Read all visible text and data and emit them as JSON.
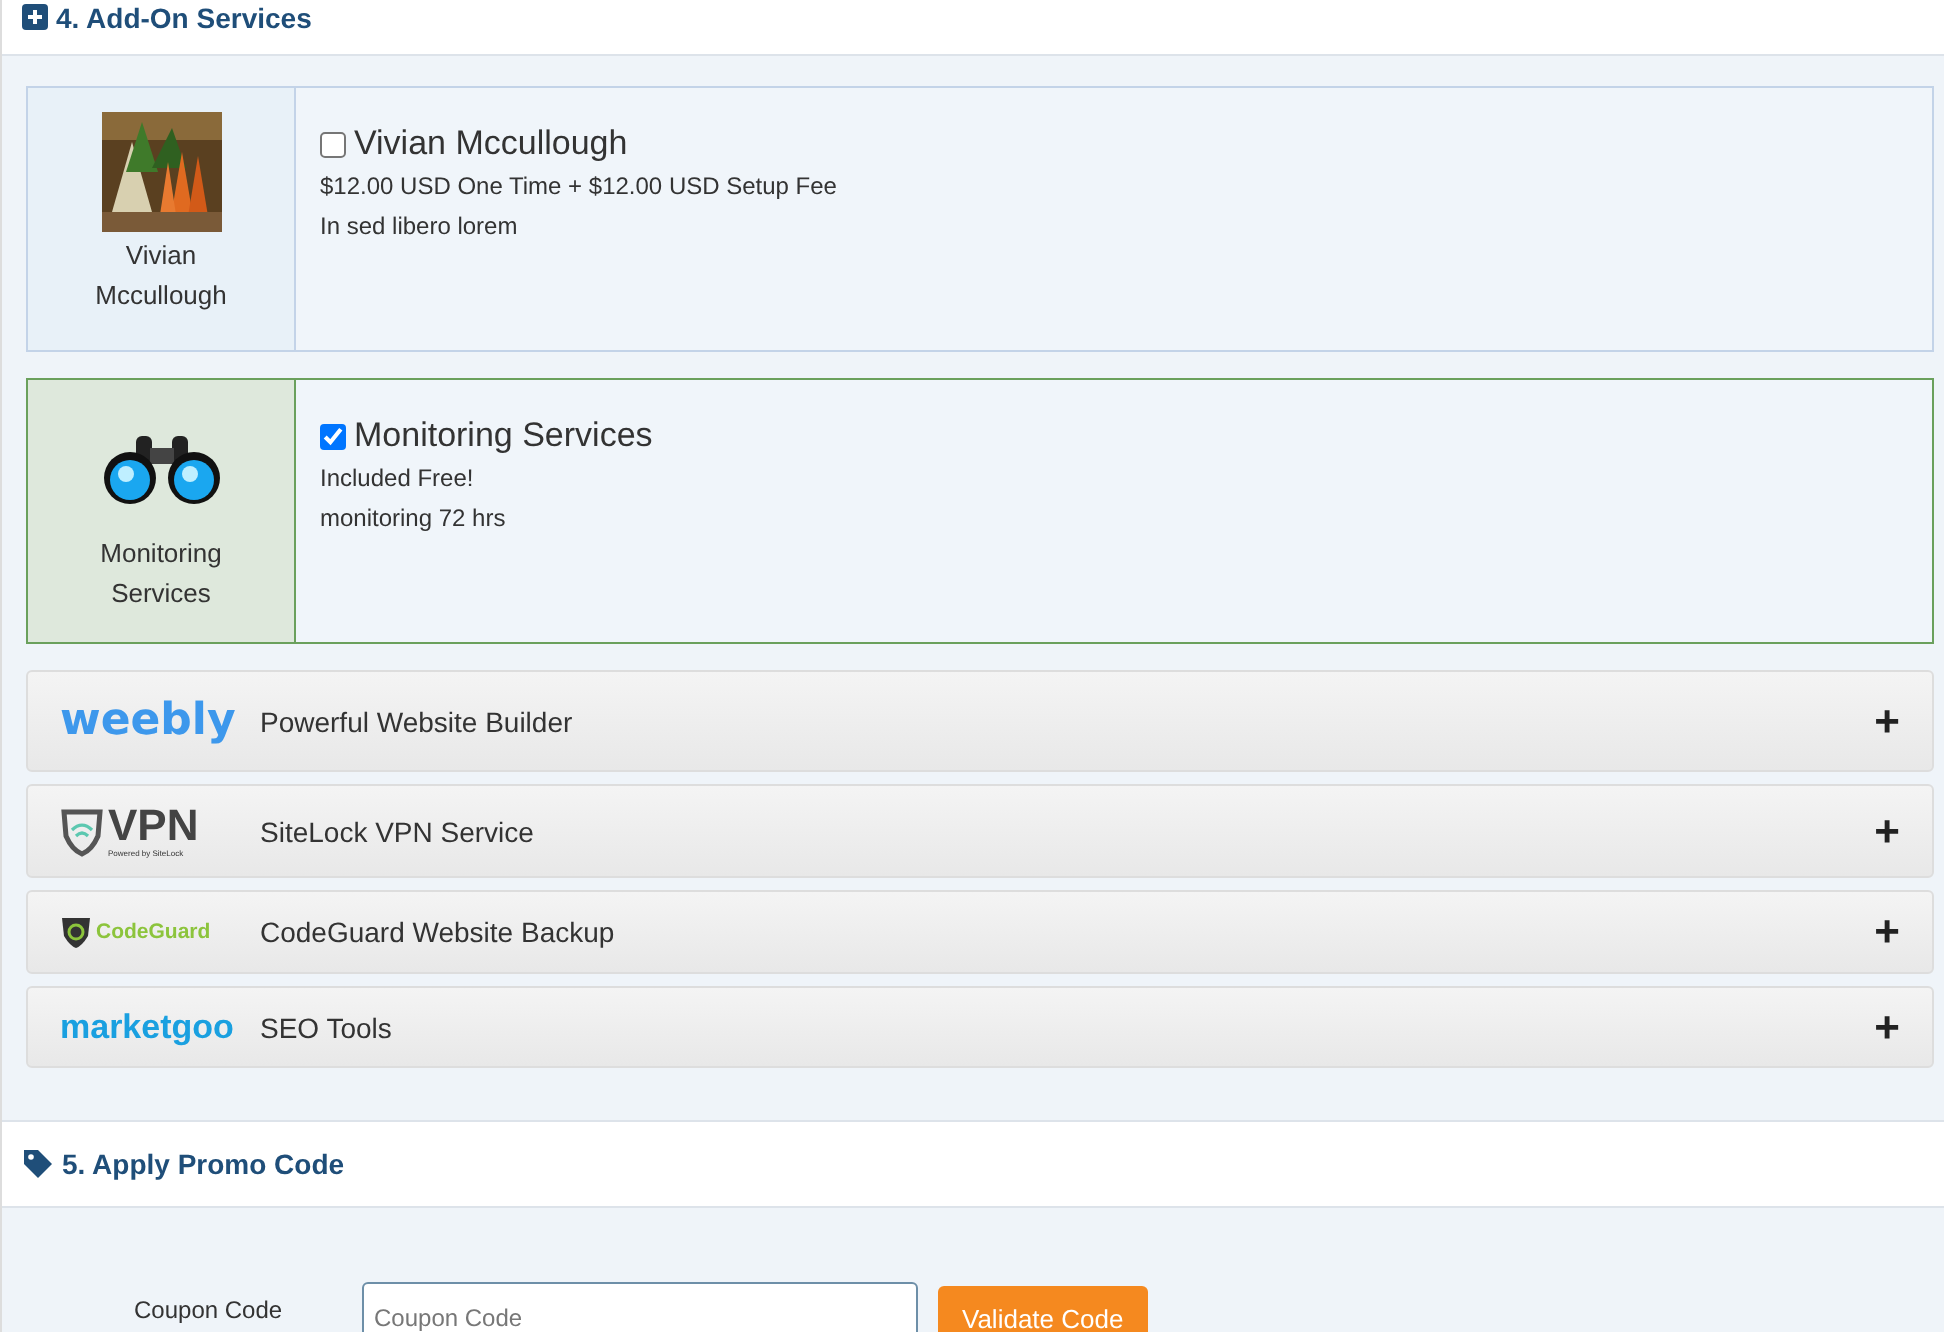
{
  "addons_section": {
    "title": "4. Add-On Services",
    "addons": [
      {
        "kind": "picture",
        "side_label": "Vivian Mccullough",
        "name": "Vivian Mccullough",
        "checked": false,
        "price": "$12.00 USD One Time + $12.00 USD Setup Fee",
        "description": "In sed libero lorem"
      },
      {
        "kind": "binoculars",
        "side_label": "Monitoring Services",
        "name": "Monitoring Services",
        "checked": true,
        "price": "Included Free!",
        "description": "monitoring 72 hrs"
      }
    ],
    "services": [
      {
        "kind": "weebly",
        "logo_text": "weebly",
        "title": "Powerful Website Builder",
        "toggle": "+"
      },
      {
        "kind": "vpn",
        "logo_text": "VPN",
        "logo_sub": "Powered by SiteLock",
        "title": "SiteLock VPN Service",
        "toggle": "+"
      },
      {
        "kind": "codeguard",
        "logo_text": "CodeGuard",
        "title": "CodeGuard Website Backup",
        "toggle": "+"
      },
      {
        "kind": "marketgoo",
        "logo_text": "marketgoo",
        "title": "SEO Tools",
        "toggle": "+"
      }
    ]
  },
  "promo_section": {
    "title": "5. Apply Promo Code",
    "label": "Coupon Code",
    "placeholder": "Coupon Code",
    "button": "Validate Code"
  }
}
